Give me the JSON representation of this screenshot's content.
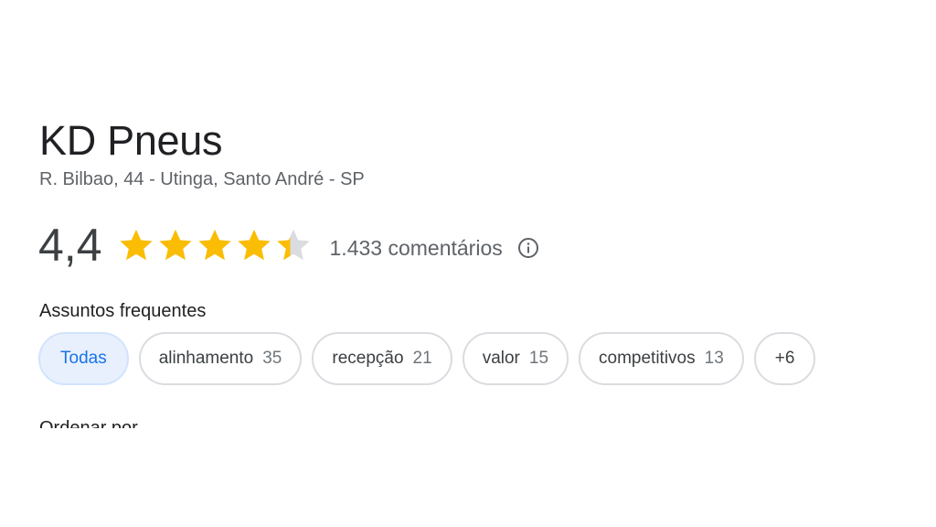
{
  "place": {
    "name": "KD Pneus",
    "address": "R. Bilbao, 44 - Utinga, Santo André - SP"
  },
  "rating": {
    "value_text": "4,4",
    "value": 4.4,
    "max_stars": 5,
    "reviews_text": "1.433 comentários",
    "star_color": "#fbbc04",
    "star_empty_color": "#dadce0",
    "info_icon": "info-icon"
  },
  "topics": {
    "heading": "Assuntos frequentes",
    "selected_color": "#1a73e8",
    "chips": [
      {
        "label": "Todas",
        "count": "",
        "selected": true
      },
      {
        "label": "alinhamento",
        "count": "35",
        "selected": false
      },
      {
        "label": "recepção",
        "count": "21",
        "selected": false
      },
      {
        "label": "valor",
        "count": "15",
        "selected": false
      },
      {
        "label": "competitivos",
        "count": "13",
        "selected": false
      }
    ],
    "more_label": "+6"
  },
  "sort": {
    "label": "Ordenar por"
  }
}
